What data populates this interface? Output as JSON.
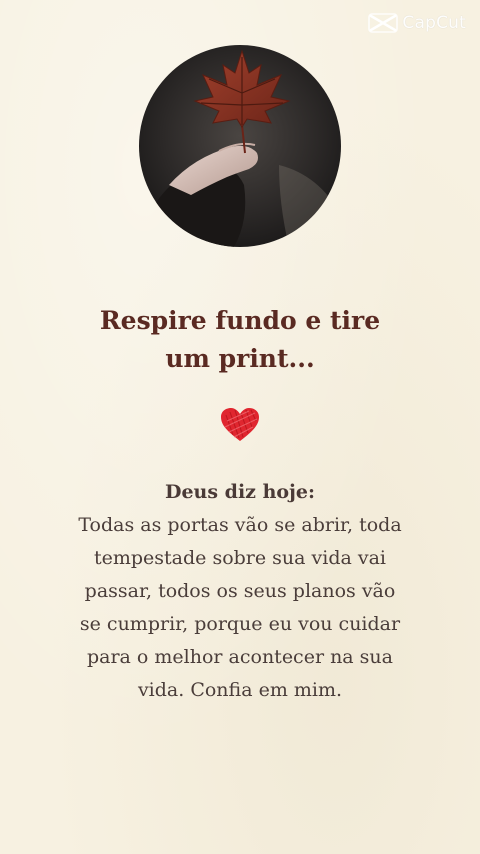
{
  "watermark": {
    "label": "CapCut",
    "icon": "capcut-logo-icon"
  },
  "photo": {
    "subject": "hand-holding-maple-leaf"
  },
  "title": {
    "lines": [
      "Respire fundo e tire",
      "um print..."
    ]
  },
  "heart": {
    "icon": "heart-icon",
    "color": "#e0262f"
  },
  "message": {
    "heading": "Deus diz hoje:",
    "lines": [
      "Todas as portas vão se abrir, toda",
      "tempestade sobre sua vida vai",
      "passar, todos os seus planos vão",
      "se cumprir, porque eu vou cuidar",
      "para o melhor acontecer na sua",
      "vida. Confia em mim."
    ]
  },
  "colors": {
    "background": "#f7f1e1",
    "title": "#5a2a22",
    "body": "#4a3d3a"
  }
}
